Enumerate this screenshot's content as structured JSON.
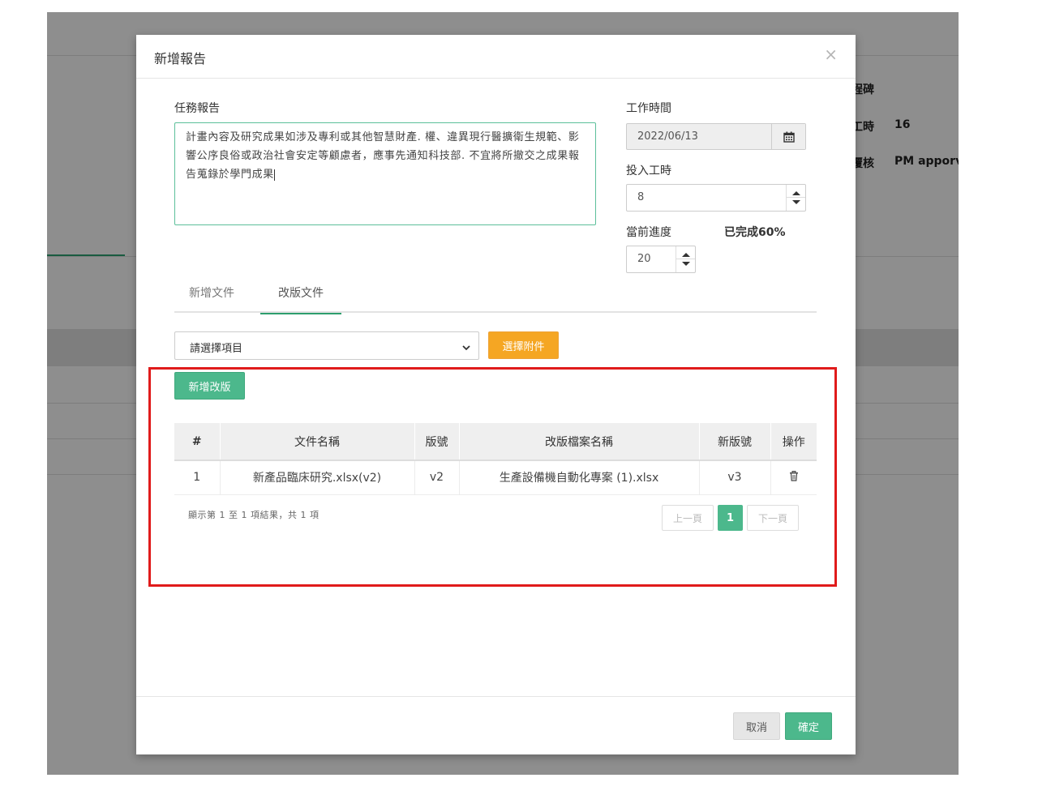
{
  "background": {
    "row1_label": "程碑",
    "row2_label": "工時",
    "row2_value": "16",
    "row3_label": "覆核",
    "row3_value": "PM apporv"
  },
  "modal": {
    "title": "新增報告",
    "close": "×",
    "task_report_label": "任務報告",
    "task_report_text": "計畫內容及研究成果如涉及專利或其他智慧財產. 權、違異現行醫擴衛生規範、影響公序良俗或政治社會安定等顧慮者，應事先通知科技部. 不宜將所撤交之成果報告蒐錄於學門成果",
    "work_time_label": "工作時間",
    "work_date": "2022/06/13",
    "hours_label": "投入工時",
    "hours_value": "8",
    "progress_label": "當前進度",
    "progress_done": "已完成60%",
    "progress_value": "20",
    "tabs": [
      {
        "label": "新增文件"
      },
      {
        "label": "改版文件"
      }
    ],
    "select_placeholder": "請選擇項目",
    "choose_attachment": "選擇附件",
    "add_revision": "新增改版",
    "table": {
      "headers": [
        "#",
        "文件名稱",
        "版號",
        "改版檔案名稱",
        "新版號",
        "操作"
      ],
      "rows": [
        {
          "no": "1",
          "doc_name": "新產品臨床研究.xlsx(v2)",
          "version": "v2",
          "revision_file": "生產設備機自動化專案 (1).xlsx",
          "new_version": "v3"
        }
      ]
    },
    "pagination_info": "顯示第 1 至 1 項結果，共 1 項",
    "prev": "上一頁",
    "page": "1",
    "next": "下一頁",
    "cancel": "取消",
    "confirm": "確定"
  },
  "colors": {
    "accent_green": "#4cb88c",
    "orange": "#f5a623",
    "highlight_red": "#e01b1b"
  },
  "icons": {
    "close": "close-icon",
    "calendar": "calendar-icon",
    "select": "chevron-down-icon",
    "delete": "trash-icon"
  }
}
